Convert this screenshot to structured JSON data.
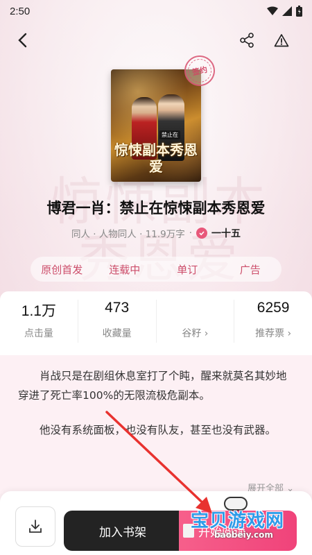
{
  "status_bar": {
    "time": "2:50"
  },
  "book": {
    "cover_title": "惊悚副本秀恩爱",
    "cover_author": "禁止在",
    "stamp_text": "签约",
    "title": "博君一肖：禁止在惊悚副本秀恩爱",
    "category": "同人 · 人物同人 · 11.9万字",
    "author": "一十五",
    "tags": [
      "原创首发",
      "连载中",
      "单订",
      "广告"
    ],
    "background_ghost_text": "惊悚副本秀恩爱"
  },
  "stats": [
    {
      "value": "1.1万",
      "label": "点击量"
    },
    {
      "value": "473",
      "label": "收藏量"
    },
    {
      "value": "",
      "label": "谷籽 ›"
    },
    {
      "value": "6259",
      "label": "推荐票 ›"
    }
  ],
  "description": {
    "paragraphs": [
      "肖战只是在剧组休息室打了个盹，醒来就莫名其妙地穿进了死亡率100%的无限流极危副本。",
      "他没有系统面板，也没有队友，甚至也没有武器。"
    ],
    "expand_label": "展开全部 ⌄"
  },
  "actions": {
    "add_shelf_label": "加入书架",
    "read_label": "开始阅读"
  },
  "watermark": {
    "text": "宝贝游戏网",
    "url": "baobeiy.com"
  },
  "colors": {
    "accent": "#f0437a",
    "tag_text": "#cc4d6a",
    "dark_button": "#232323"
  }
}
